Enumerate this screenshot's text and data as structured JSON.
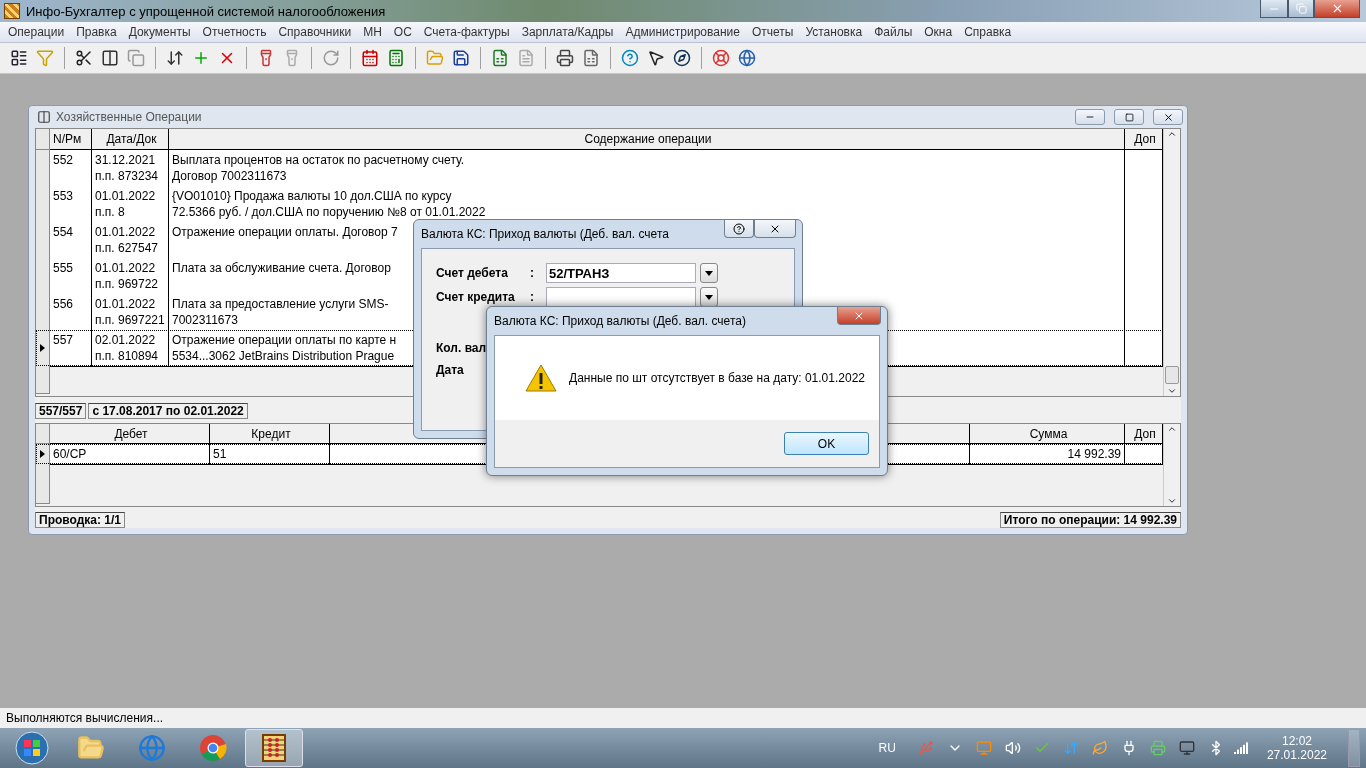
{
  "app": {
    "title": "Инфо-Бухгалтер с упрощенной системой налогообложения"
  },
  "menu": [
    "Операции",
    "Правка",
    "Документы",
    "Отчетность",
    "Справочники",
    "МН",
    "ОС",
    "Счета-фактуры",
    "Зарплата/Кадры",
    "Администрирование",
    "Отчеты",
    "Установка",
    "Файлы",
    "Окна",
    "Справка"
  ],
  "operations_window": {
    "title": "Хозяйственные Операции",
    "columns": [
      "N/Рм",
      "Дата/Док",
      "Содержание операции",
      "Доп"
    ],
    "rows": [
      {
        "number": "552",
        "date": "31.12.2021",
        "doc": "п.п. 873234",
        "content": [
          "Выплата процентов на остаток по расчетному счету.",
          "Договор 7002311673"
        ],
        "selected": false
      },
      {
        "number": "553",
        "date": "01.01.2022",
        "doc": "п.п. 8",
        "content": [
          "{VO01010} Продажа валюты 10 дол.США по курсу",
          "72.5366 руб. / дол.США по поручению №8 от 01.01.2022"
        ],
        "selected": false
      },
      {
        "number": "554",
        "date": "01.01.2022",
        "doc": "п.п. 627547",
        "content": [
          "Отражение операции оплаты. Договор 7"
        ],
        "selected": false
      },
      {
        "number": "555",
        "date": "01.01.2022",
        "doc": "п.п. 969722",
        "content": [
          "Плата за обслуживание счета. Договор"
        ],
        "selected": false
      },
      {
        "number": "556",
        "date": "01.01.2022",
        "doc": "п.п. 9697221",
        "content": [
          "Плата за предоставление услуги SMS-",
          "7002311673"
        ],
        "selected": false
      },
      {
        "number": "557",
        "date": "02.01.2022",
        "doc": "п.п. 810894",
        "content": [
          "Отражение операции оплаты по карте н",
          "5534...3062 JetBrains Distribution Prague"
        ],
        "selected": true
      }
    ],
    "record_count": "557/557",
    "period": "с 17.08.2017 по 02.01.2022",
    "entries": {
      "columns": [
        "Дебет",
        "Кредит",
        "Сумма",
        "Доп"
      ],
      "rows": [
        {
          "debit": "60/СР",
          "credit": "51",
          "amount": "14 992.39",
          "selected": true
        }
      ]
    },
    "entry_count": "Проводка: 1/1",
    "total": "Итого по операции: 14 992.39"
  },
  "currency_dialog": {
    "title": "Валюта КС: Приход валюты (Деб. вал. счета",
    "fields": [
      {
        "kind": "combo",
        "label": "Счет дебета",
        "separator": ":",
        "value": "52/ТРАНЗ"
      },
      {
        "kind": "combo",
        "label": "Счет кредита",
        "separator": ":"
      },
      {
        "kind": "plain",
        "label": "Кол. вал"
      },
      {
        "kind": "plain",
        "label": "Дата"
      }
    ]
  },
  "message_box": {
    "title": "Валюта КС: Приход валюты (Деб. вал. счета)",
    "message": "Данные по шт отсутствует в базе на дату: 01.01.2022",
    "button": "OK"
  },
  "status_bar": "Выполняются вычисления...",
  "taskbar": {
    "language": "RU",
    "time": "12:02",
    "date": "27.01.2022"
  }
}
